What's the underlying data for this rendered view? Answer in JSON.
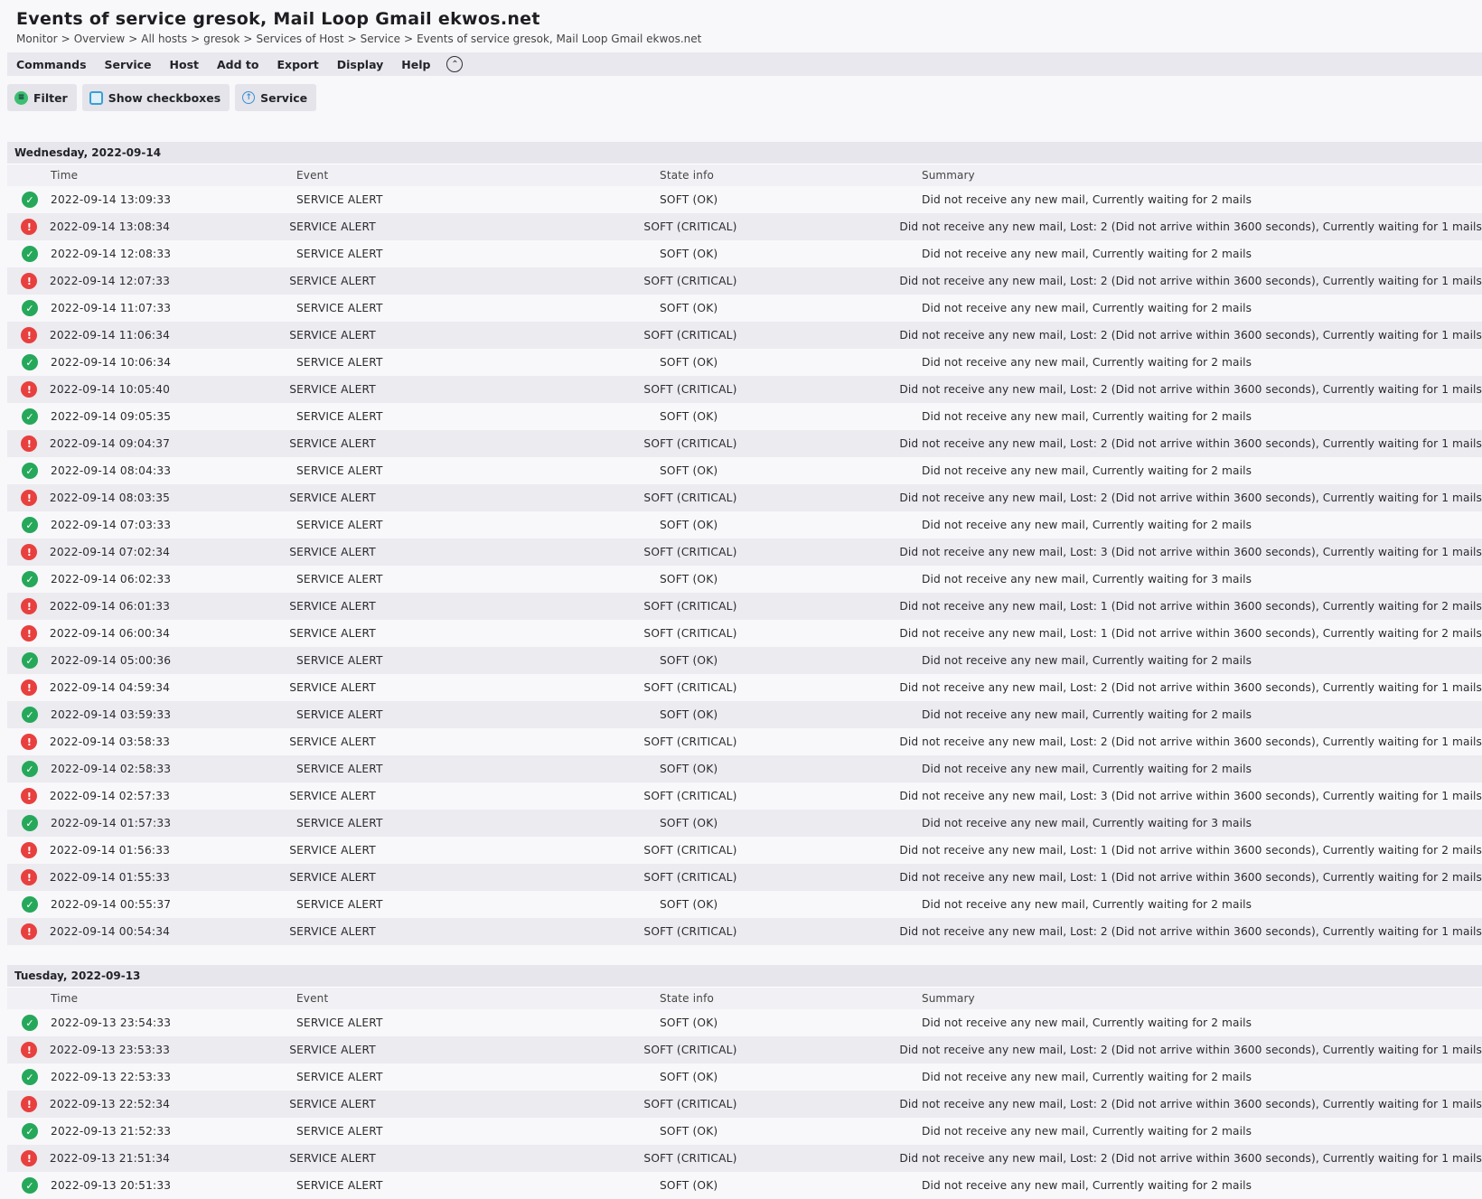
{
  "title": "Events of service gresok, Mail Loop Gmail ekwos.net",
  "breadcrumb": [
    "Monitor",
    "Overview",
    "All hosts",
    "gresok",
    "Services of Host",
    "Service",
    "Events of service gresok, Mail Loop Gmail ekwos.net"
  ],
  "breadcrumb_sep": ">",
  "menu": [
    "Commands",
    "Service",
    "Host",
    "Add to",
    "Export",
    "Display",
    "Help"
  ],
  "toolbar": {
    "filter": "Filter",
    "checkboxes": "Show checkboxes",
    "service": "Service"
  },
  "columns": {
    "time": "Time",
    "event": "Event",
    "state": "State info",
    "summary": "Summary"
  },
  "days": [
    {
      "label": "Wednesday, 2022-09-14",
      "rows": [
        {
          "status": "ok",
          "time": "2022-09-14 13:09:33",
          "event": "SERVICE ALERT",
          "state": "SOFT (OK)",
          "summary": "Did not receive any new mail, Currently waiting for 2 mails"
        },
        {
          "status": "crit",
          "time": "2022-09-14 13:08:34",
          "event": "SERVICE ALERT",
          "state": "SOFT (CRITICAL)",
          "summary": "Did not receive any new mail, Lost: 2 (Did not arrive within 3600 seconds), Currently waiting for 1 mails"
        },
        {
          "status": "ok",
          "time": "2022-09-14 12:08:33",
          "event": "SERVICE ALERT",
          "state": "SOFT (OK)",
          "summary": "Did not receive any new mail, Currently waiting for 2 mails"
        },
        {
          "status": "crit",
          "time": "2022-09-14 12:07:33",
          "event": "SERVICE ALERT",
          "state": "SOFT (CRITICAL)",
          "summary": "Did not receive any new mail, Lost: 2 (Did not arrive within 3600 seconds), Currently waiting for 1 mails"
        },
        {
          "status": "ok",
          "time": "2022-09-14 11:07:33",
          "event": "SERVICE ALERT",
          "state": "SOFT (OK)",
          "summary": "Did not receive any new mail, Currently waiting for 2 mails"
        },
        {
          "status": "crit",
          "time": "2022-09-14 11:06:34",
          "event": "SERVICE ALERT",
          "state": "SOFT (CRITICAL)",
          "summary": "Did not receive any new mail, Lost: 2 (Did not arrive within 3600 seconds), Currently waiting for 1 mails"
        },
        {
          "status": "ok",
          "time": "2022-09-14 10:06:34",
          "event": "SERVICE ALERT",
          "state": "SOFT (OK)",
          "summary": "Did not receive any new mail, Currently waiting for 2 mails"
        },
        {
          "status": "crit",
          "time": "2022-09-14 10:05:40",
          "event": "SERVICE ALERT",
          "state": "SOFT (CRITICAL)",
          "summary": "Did not receive any new mail, Lost: 2 (Did not arrive within 3600 seconds), Currently waiting for 1 mails"
        },
        {
          "status": "ok",
          "time": "2022-09-14 09:05:35",
          "event": "SERVICE ALERT",
          "state": "SOFT (OK)",
          "summary": "Did not receive any new mail, Currently waiting for 2 mails"
        },
        {
          "status": "crit",
          "time": "2022-09-14 09:04:37",
          "event": "SERVICE ALERT",
          "state": "SOFT (CRITICAL)",
          "summary": "Did not receive any new mail, Lost: 2 (Did not arrive within 3600 seconds), Currently waiting for 1 mails"
        },
        {
          "status": "ok",
          "time": "2022-09-14 08:04:33",
          "event": "SERVICE ALERT",
          "state": "SOFT (OK)",
          "summary": "Did not receive any new mail, Currently waiting for 2 mails"
        },
        {
          "status": "crit",
          "time": "2022-09-14 08:03:35",
          "event": "SERVICE ALERT",
          "state": "SOFT (CRITICAL)",
          "summary": "Did not receive any new mail, Lost: 2 (Did not arrive within 3600 seconds), Currently waiting for 1 mails"
        },
        {
          "status": "ok",
          "time": "2022-09-14 07:03:33",
          "event": "SERVICE ALERT",
          "state": "SOFT (OK)",
          "summary": "Did not receive any new mail, Currently waiting for 2 mails"
        },
        {
          "status": "crit",
          "time": "2022-09-14 07:02:34",
          "event": "SERVICE ALERT",
          "state": "SOFT (CRITICAL)",
          "summary": "Did not receive any new mail, Lost: 3 (Did not arrive within 3600 seconds), Currently waiting for 1 mails"
        },
        {
          "status": "ok",
          "time": "2022-09-14 06:02:33",
          "event": "SERVICE ALERT",
          "state": "SOFT (OK)",
          "summary": "Did not receive any new mail, Currently waiting for 3 mails"
        },
        {
          "status": "crit",
          "time": "2022-09-14 06:01:33",
          "event": "SERVICE ALERT",
          "state": "SOFT (CRITICAL)",
          "summary": "Did not receive any new mail, Lost: 1 (Did not arrive within 3600 seconds), Currently waiting for 2 mails"
        },
        {
          "status": "crit",
          "time": "2022-09-14 06:00:34",
          "event": "SERVICE ALERT",
          "state": "SOFT (CRITICAL)",
          "summary": "Did not receive any new mail, Lost: 1 (Did not arrive within 3600 seconds), Currently waiting for 2 mails"
        },
        {
          "status": "ok",
          "time": "2022-09-14 05:00:36",
          "event": "SERVICE ALERT",
          "state": "SOFT (OK)",
          "summary": "Did not receive any new mail, Currently waiting for 2 mails"
        },
        {
          "status": "crit",
          "time": "2022-09-14 04:59:34",
          "event": "SERVICE ALERT",
          "state": "SOFT (CRITICAL)",
          "summary": "Did not receive any new mail, Lost: 2 (Did not arrive within 3600 seconds), Currently waiting for 1 mails"
        },
        {
          "status": "ok",
          "time": "2022-09-14 03:59:33",
          "event": "SERVICE ALERT",
          "state": "SOFT (OK)",
          "summary": "Did not receive any new mail, Currently waiting for 2 mails"
        },
        {
          "status": "crit",
          "time": "2022-09-14 03:58:33",
          "event": "SERVICE ALERT",
          "state": "SOFT (CRITICAL)",
          "summary": "Did not receive any new mail, Lost: 2 (Did not arrive within 3600 seconds), Currently waiting for 1 mails"
        },
        {
          "status": "ok",
          "time": "2022-09-14 02:58:33",
          "event": "SERVICE ALERT",
          "state": "SOFT (OK)",
          "summary": "Did not receive any new mail, Currently waiting for 2 mails"
        },
        {
          "status": "crit",
          "time": "2022-09-14 02:57:33",
          "event": "SERVICE ALERT",
          "state": "SOFT (CRITICAL)",
          "summary": "Did not receive any new mail, Lost: 3 (Did not arrive within 3600 seconds), Currently waiting for 1 mails"
        },
        {
          "status": "ok",
          "time": "2022-09-14 01:57:33",
          "event": "SERVICE ALERT",
          "state": "SOFT (OK)",
          "summary": "Did not receive any new mail, Currently waiting for 3 mails"
        },
        {
          "status": "crit",
          "time": "2022-09-14 01:56:33",
          "event": "SERVICE ALERT",
          "state": "SOFT (CRITICAL)",
          "summary": "Did not receive any new mail, Lost: 1 (Did not arrive within 3600 seconds), Currently waiting for 2 mails"
        },
        {
          "status": "crit",
          "time": "2022-09-14 01:55:33",
          "event": "SERVICE ALERT",
          "state": "SOFT (CRITICAL)",
          "summary": "Did not receive any new mail, Lost: 1 (Did not arrive within 3600 seconds), Currently waiting for 2 mails"
        },
        {
          "status": "ok",
          "time": "2022-09-14 00:55:37",
          "event": "SERVICE ALERT",
          "state": "SOFT (OK)",
          "summary": "Did not receive any new mail, Currently waiting for 2 mails"
        },
        {
          "status": "crit",
          "time": "2022-09-14 00:54:34",
          "event": "SERVICE ALERT",
          "state": "SOFT (CRITICAL)",
          "summary": "Did not receive any new mail, Lost: 2 (Did not arrive within 3600 seconds), Currently waiting for 1 mails"
        }
      ]
    },
    {
      "label": "Tuesday, 2022-09-13",
      "rows": [
        {
          "status": "ok",
          "time": "2022-09-13 23:54:33",
          "event": "SERVICE ALERT",
          "state": "SOFT (OK)",
          "summary": "Did not receive any new mail, Currently waiting for 2 mails"
        },
        {
          "status": "crit",
          "time": "2022-09-13 23:53:33",
          "event": "SERVICE ALERT",
          "state": "SOFT (CRITICAL)",
          "summary": "Did not receive any new mail, Lost: 2 (Did not arrive within 3600 seconds), Currently waiting for 1 mails"
        },
        {
          "status": "ok",
          "time": "2022-09-13 22:53:33",
          "event": "SERVICE ALERT",
          "state": "SOFT (OK)",
          "summary": "Did not receive any new mail, Currently waiting for 2 mails"
        },
        {
          "status": "crit",
          "time": "2022-09-13 22:52:34",
          "event": "SERVICE ALERT",
          "state": "SOFT (CRITICAL)",
          "summary": "Did not receive any new mail, Lost: 2 (Did not arrive within 3600 seconds), Currently waiting for 1 mails"
        },
        {
          "status": "ok",
          "time": "2022-09-13 21:52:33",
          "event": "SERVICE ALERT",
          "state": "SOFT (OK)",
          "summary": "Did not receive any new mail, Currently waiting for 2 mails"
        },
        {
          "status": "crit",
          "time": "2022-09-13 21:51:34",
          "event": "SERVICE ALERT",
          "state": "SOFT (CRITICAL)",
          "summary": "Did not receive any new mail, Lost: 2 (Did not arrive within 3600 seconds), Currently waiting for 1 mails"
        },
        {
          "status": "ok",
          "time": "2022-09-13 20:51:33",
          "event": "SERVICE ALERT",
          "state": "SOFT (OK)",
          "summary": "Did not receive any new mail, Currently waiting for 2 mails"
        }
      ]
    }
  ],
  "colors": {
    "ok": "#26a85a",
    "crit": "#e8403e",
    "accent": "#3a9fd6"
  },
  "icons": {
    "ok": "check-circle-icon",
    "crit": "exclamation-circle-icon",
    "filter": "filter-icon",
    "checkboxes": "checkbox-icon",
    "service": "arrow-up-circle-icon",
    "collapse": "chevron-up-circle-icon"
  }
}
